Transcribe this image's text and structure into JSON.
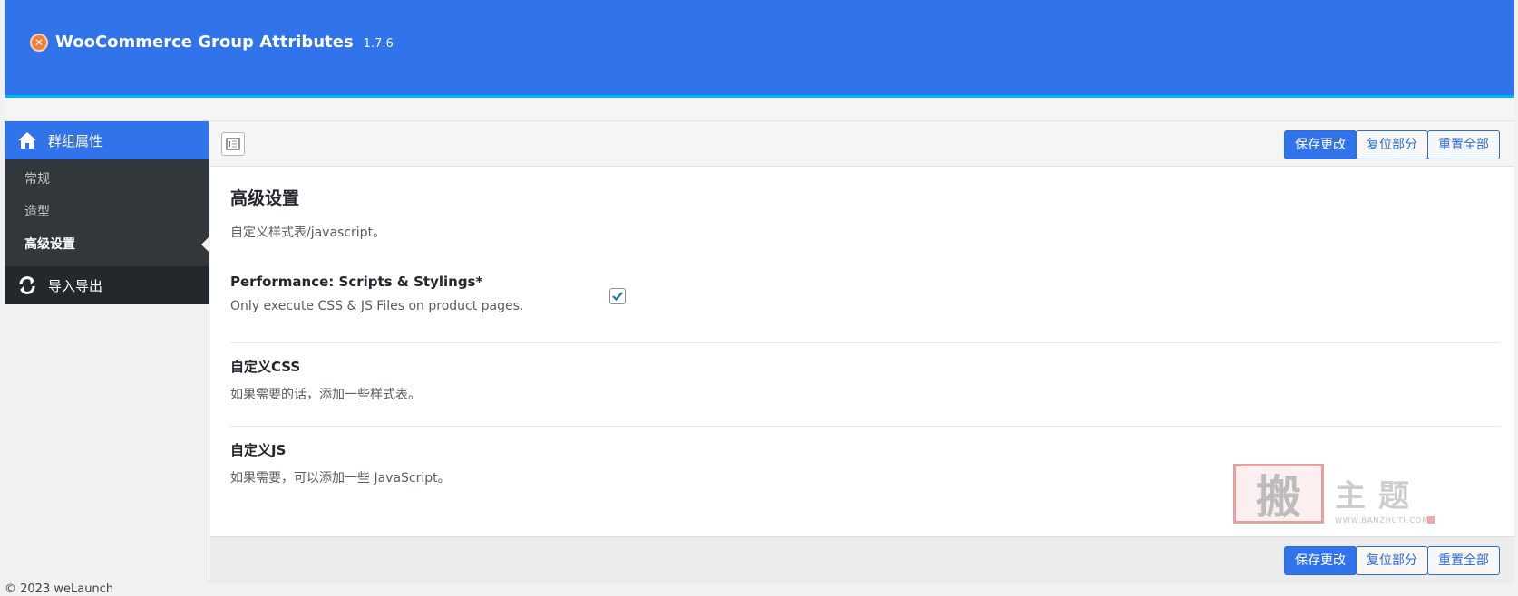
{
  "header": {
    "plugin_name": "WooCommerce Group Attributes",
    "version": "1.7.6"
  },
  "sidebar": {
    "main_label": "群组属性",
    "items": [
      {
        "label": "常规"
      },
      {
        "label": "造型"
      },
      {
        "label": "高级设置"
      }
    ],
    "export_label": "导入导出"
  },
  "toolbar": {
    "save_label": "保存更改",
    "reset_section_label": "复位部分",
    "reset_all_label": "重置全部"
  },
  "section": {
    "title": "高级设置",
    "description": "自定义样式表/javascript。"
  },
  "fields": [
    {
      "title": "Performance: Scripts & Stylings*",
      "description": "Only execute CSS & JS Files on product pages.",
      "checked": true
    },
    {
      "title": "自定义CSS",
      "description": "如果需要的话，添加一些样式表。"
    },
    {
      "title": "自定义JS",
      "description": "如果需要，可以添加一些 JavaScript。"
    }
  ],
  "footer": {
    "copyright": "© 2023 weLaunch"
  },
  "watermark": {
    "seal_char": "搬",
    "text": "主题",
    "url": "WWW.BANZHUTI.COM"
  },
  "colors": {
    "accent": "#3173eb",
    "sidebar_dark": "#32373c"
  }
}
